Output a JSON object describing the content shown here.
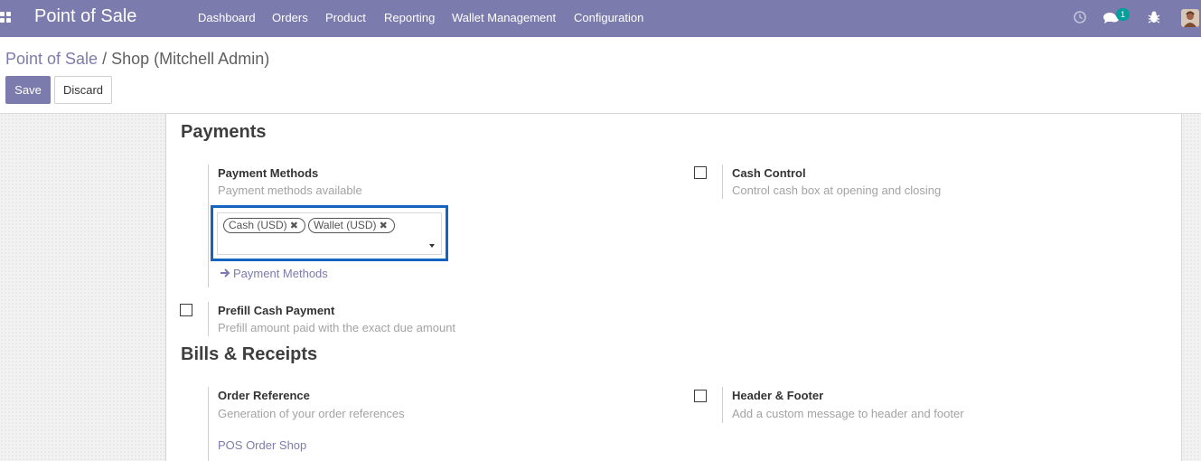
{
  "navbar": {
    "app_name": "Point of Sale",
    "menu": [
      "Dashboard",
      "Orders",
      "Product",
      "Reporting",
      "Wallet Management",
      "Configuration"
    ],
    "messages_badge": "1",
    "icons": [
      "apps-grid-icon",
      "clock-icon",
      "chat-icon",
      "bug-icon",
      "user-avatar"
    ]
  },
  "control_panel": {
    "breadcrumb_root": "Point of Sale",
    "breadcrumb_sep": "/",
    "breadcrumb_current": "Shop (Mitchell Admin)",
    "save_label": "Save",
    "discard_label": "Discard"
  },
  "payments": {
    "title": "Payments",
    "payment_methods": {
      "label": "Payment Methods",
      "help": "Payment methods available",
      "tags": [
        {
          "label": "Cash (USD)"
        },
        {
          "label": "Wallet (USD)"
        }
      ],
      "link": "Payment Methods"
    },
    "cash_control": {
      "label": "Cash Control",
      "help": "Control cash box at opening and closing",
      "checked": false
    },
    "prefill": {
      "label": "Prefill Cash Payment",
      "help": "Prefill amount paid with the exact due amount",
      "checked": false
    }
  },
  "bills": {
    "title": "Bills & Receipts",
    "order_reference": {
      "label": "Order Reference",
      "help": "Generation of your order references",
      "value": "POS Order Shop"
    },
    "header_footer": {
      "label": "Header & Footer",
      "help": "Add a custom message to header and footer",
      "checked": false
    }
  },
  "colors": {
    "brand": "#7c7bad",
    "badge": "#00a09d",
    "highlight_border": "#1565c0"
  }
}
